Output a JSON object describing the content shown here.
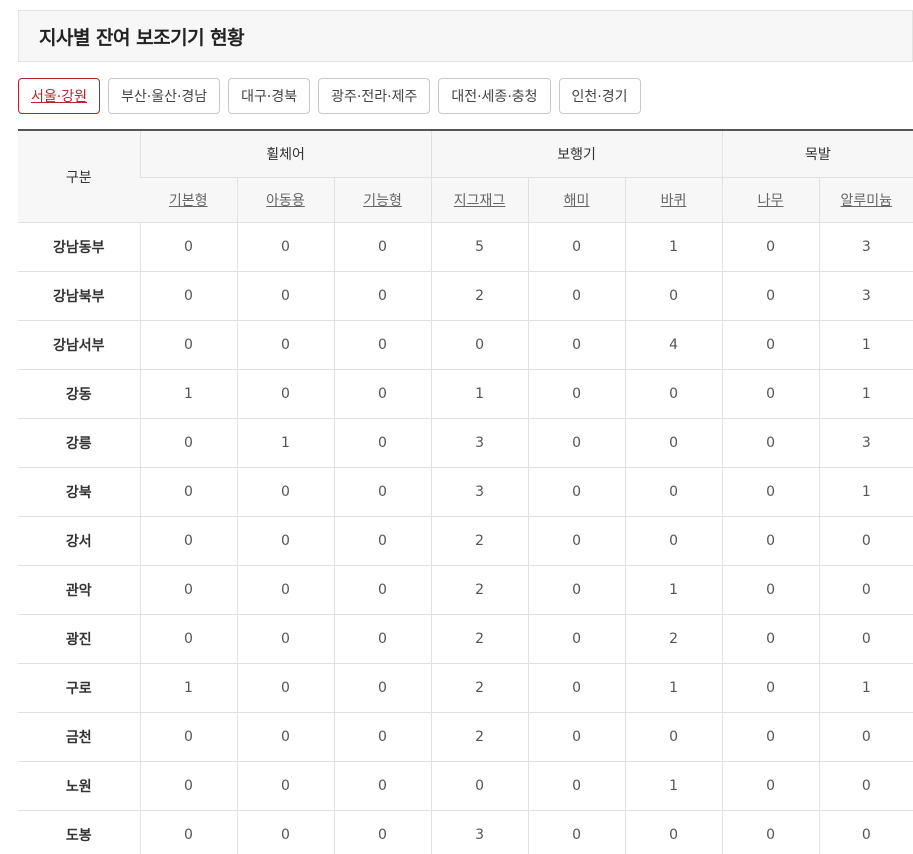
{
  "title": "지사별 잔여 보조기기 현황",
  "tabs": [
    {
      "label": "서울·강원",
      "active": true
    },
    {
      "label": "부산·울산·경남",
      "active": false
    },
    {
      "label": "대구·경북",
      "active": false
    },
    {
      "label": "광주·전라·제주",
      "active": false
    },
    {
      "label": "대전·세종·충청",
      "active": false
    },
    {
      "label": "인천·경기",
      "active": false
    }
  ],
  "table": {
    "corner": "구분",
    "groups": [
      "휠체어",
      "보행기",
      "목발"
    ],
    "columns": [
      "기본형",
      "아동용",
      "기능형",
      "지그재그",
      "해미",
      "바퀴",
      "나무",
      "알루미늄"
    ],
    "rows": [
      {
        "name": "강남동부",
        "values": [
          "0",
          "0",
          "0",
          "5",
          "0",
          "1",
          "0",
          "3"
        ]
      },
      {
        "name": "강남북부",
        "values": [
          "0",
          "0",
          "0",
          "2",
          "0",
          "0",
          "0",
          "3"
        ]
      },
      {
        "name": "강남서부",
        "values": [
          "0",
          "0",
          "0",
          "0",
          "0",
          "4",
          "0",
          "1"
        ]
      },
      {
        "name": "강동",
        "values": [
          "1",
          "0",
          "0",
          "1",
          "0",
          "0",
          "0",
          "1"
        ]
      },
      {
        "name": "강릉",
        "values": [
          "0",
          "1",
          "0",
          "3",
          "0",
          "0",
          "0",
          "3"
        ]
      },
      {
        "name": "강북",
        "values": [
          "0",
          "0",
          "0",
          "3",
          "0",
          "0",
          "0",
          "1"
        ]
      },
      {
        "name": "강서",
        "values": [
          "0",
          "0",
          "0",
          "2",
          "0",
          "0",
          "0",
          "0"
        ]
      },
      {
        "name": "관악",
        "values": [
          "0",
          "0",
          "0",
          "2",
          "0",
          "1",
          "0",
          "0"
        ]
      },
      {
        "name": "광진",
        "values": [
          "0",
          "0",
          "0",
          "2",
          "0",
          "2",
          "0",
          "0"
        ]
      },
      {
        "name": "구로",
        "values": [
          "1",
          "0",
          "0",
          "2",
          "0",
          "1",
          "0",
          "1"
        ]
      },
      {
        "name": "금천",
        "values": [
          "0",
          "0",
          "0",
          "2",
          "0",
          "0",
          "0",
          "0"
        ]
      },
      {
        "name": "노원",
        "values": [
          "0",
          "0",
          "0",
          "0",
          "0",
          "1",
          "0",
          "0"
        ]
      },
      {
        "name": "도봉",
        "values": [
          "0",
          "0",
          "0",
          "3",
          "0",
          "0",
          "0",
          "0"
        ]
      }
    ]
  }
}
